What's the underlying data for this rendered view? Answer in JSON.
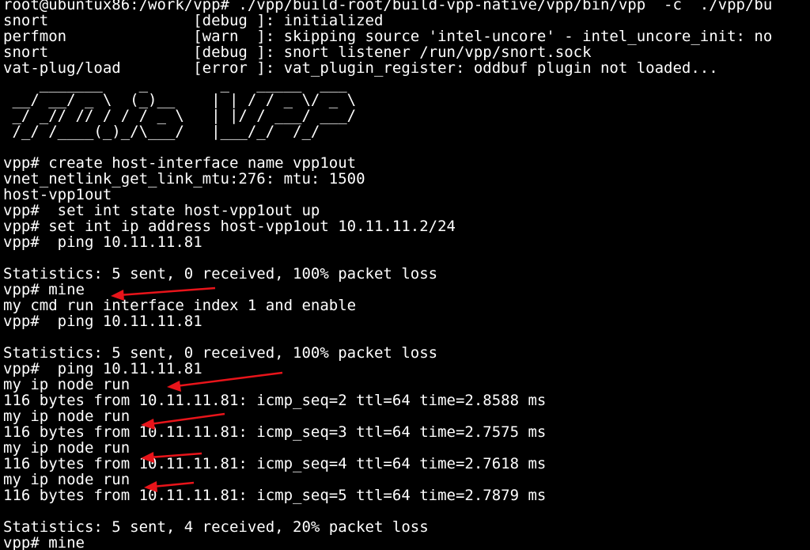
{
  "terminal": {
    "background": "#000000",
    "foreground": "#ffffff",
    "lines": [
      "root@ubuntux86:/work/vpp# ./vpp/build-root/build-vpp-native/vpp/bin/vpp  -c  ./vpp/bu",
      "snort                [debug ]: initialized",
      "perfmon              [warn  ]: skipping source 'intel-uncore' - intel_uncore_init: no",
      "snort                [debug ]: snort listener /run/vpp/snort.sock",
      "vat-plug/load        [error ]: vat_plugin_register: oddbuf plugin not loaded...",
      "    _______    _        _   _____  ___",
      " __/ __/ _ \\  (_)__    | | / / _ \\/ _ \\",
      " _/ _// // / / / _ \\   | |/ / ___/ ___/",
      " /_/ /____(_)_/\\___/   |___/_/  /_/",
      "",
      "vpp# create host-interface name vpp1out",
      "vnet_netlink_get_link_mtu:276: mtu: 1500",
      "host-vpp1out",
      "vpp#  set int state host-vpp1out up",
      "vpp# set int ip address host-vpp1out 10.11.11.2/24",
      "vpp#  ping 10.11.11.81",
      "",
      "Statistics: 5 sent, 0 received, 100% packet loss",
      "vpp# mine",
      "my cmd run interface index 1 and enable",
      "vpp#  ping 10.11.11.81",
      "",
      "Statistics: 5 sent, 0 received, 100% packet loss",
      "vpp#  ping 10.11.11.81",
      "my ip node run",
      "116 bytes from 10.11.11.81: icmp_seq=2 ttl=64 time=2.8588 ms",
      "my ip node run",
      "116 bytes from 10.11.11.81: icmp_seq=3 ttl=64 time=2.7575 ms",
      "my ip node run",
      "116 bytes from 10.11.11.81: icmp_seq=4 ttl=64 time=2.7618 ms",
      "my ip node run",
      "116 bytes from 10.11.11.81: icmp_seq=5 ttl=64 time=2.7879 ms",
      "",
      "Statistics: 5 sent, 4 received, 20% packet loss",
      "vpp# mine"
    ]
  },
  "annotations": {
    "arrow_color": "#e8141a"
  }
}
